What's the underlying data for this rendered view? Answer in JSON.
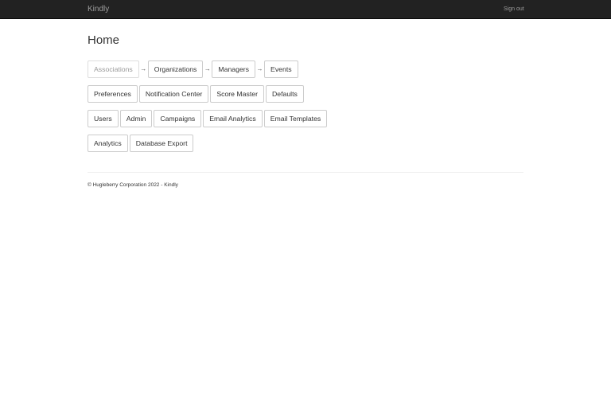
{
  "app": {
    "brand": "Kindly",
    "sign_out": "Sign out"
  },
  "page": {
    "title": "Home"
  },
  "rows": [
    {
      "items": [
        "Associations",
        "Organizations",
        "Managers",
        "Events"
      ],
      "arrow": "→"
    },
    {
      "items": [
        "Preferences",
        "Notification Center",
        "Score Master",
        "Defaults"
      ]
    },
    {
      "items": [
        "Users",
        "Admin",
        "Campaigns",
        "Email Analytics",
        "Email Templates"
      ]
    },
    {
      "items": [
        "Analytics",
        "Database Export"
      ]
    }
  ],
  "footer": {
    "text": "© Hugleberry Corporation 2022 - Kindly"
  },
  "colors": {
    "navbar": "#222222",
    "nav_text": "#9d9d9d",
    "button_border": "#cccccc",
    "disabled_text": "#9a9a9a"
  }
}
